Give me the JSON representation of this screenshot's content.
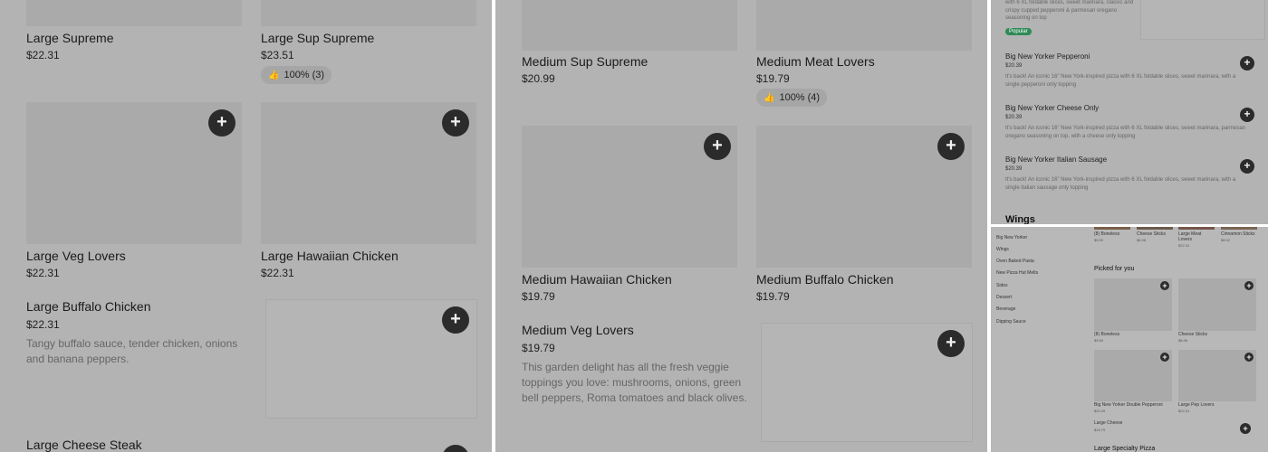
{
  "panel_a": {
    "top_items": [
      {
        "name": "Large Supreme",
        "price": "$22.31"
      },
      {
        "name": "Large Sup Supreme",
        "price": "$23.51",
        "rating": "100% (3)"
      }
    ],
    "grid_items": [
      {
        "name": "Large Veg Lovers",
        "price": "$22.31"
      },
      {
        "name": "Large Hawaiian Chicken",
        "price": "$22.31"
      }
    ],
    "list_item": {
      "name": "Large Buffalo Chicken",
      "price": "$22.31",
      "description": "Tangy buffalo sauce, tender chicken, onions and banana peppers."
    },
    "bottom_item": {
      "name": "Large Cheese Steak"
    }
  },
  "panel_b": {
    "top_items": [
      {
        "name": "Medium Sup Supreme",
        "price": "$20.99"
      },
      {
        "name": "Medium Meat Lovers",
        "price": "$19.79",
        "rating": "100% (4)"
      }
    ],
    "grid_items": [
      {
        "name": "Medium Hawaiian Chicken",
        "price": "$19.79"
      },
      {
        "name": "Medium Buffalo Chicken",
        "price": "$19.79"
      }
    ],
    "list_item": {
      "name": "Medium Veg Lovers",
      "price": "$19.79",
      "description": "This garden delight has all the fresh veggie toppings you love: mushrooms, onions, green bell peppers, Roma tomatoes and black olives."
    }
  },
  "panel_c": {
    "top_description": "with 6 XL foldable slices, sweet marinara, classic and crispy cupped pepperoni & parmesan oregano seasoning on top",
    "badge": "Popular",
    "items": [
      {
        "name": "Big New Yorker Pepperoni",
        "price": "$20.39",
        "description": "It's back! An iconic 16\" New York-inspired pizza with 6 XL foldable slices, sweet marinara, with a single pepperoni only topping"
      },
      {
        "name": "Big New Yorker Cheese Only",
        "price": "$20.39",
        "description": "It's back! An iconic 16\" New York-inspired pizza with 6 XL foldable slices, sweet marinara, parmesan oregano seasoning on top, with a cheese only topping"
      },
      {
        "name": "Big New Yorker Italian Sausage",
        "price": "$20.39",
        "description": "It's back! An iconic 16\" New York-inspired pizza with 6 XL foldable slices, sweet marinara, with a single italian sausage only topping"
      }
    ],
    "section_heading": "Wings"
  },
  "panel_d": {
    "nav": [
      "Big New Yorker",
      "Wings",
      "Oven Baked Pasta",
      "New Pizza Hut Melts",
      "Sides",
      "Dessert",
      "Beverage",
      "Dipping Sauce"
    ],
    "strip": [
      {
        "name": "(8) Boneless",
        "price": "$9.59"
      },
      {
        "name": "Cheese Sticks",
        "price": "$8.98"
      },
      {
        "name": "Large Meat Lovers",
        "price": "$22.31"
      },
      {
        "name": "Cinnamon Sticks",
        "price": "$8.02"
      }
    ],
    "picked_heading": "Picked for you",
    "picked": [
      {
        "name": "(8) Boneless",
        "price": "$9.59"
      },
      {
        "name": "Cheese Sticks",
        "price": "$8.98"
      },
      {
        "name": "Big New Yorker Double Pepperoni",
        "price": "$20.39"
      },
      {
        "name": "Large Pep Lovers",
        "price": "$22.31"
      }
    ],
    "list_item": {
      "name": "Large Cheese",
      "price": "$19.79"
    },
    "next_heading": "Large Specialty Pizza"
  },
  "icons": {
    "add": "plus-icon",
    "thumb": "thumbs-up-icon"
  }
}
